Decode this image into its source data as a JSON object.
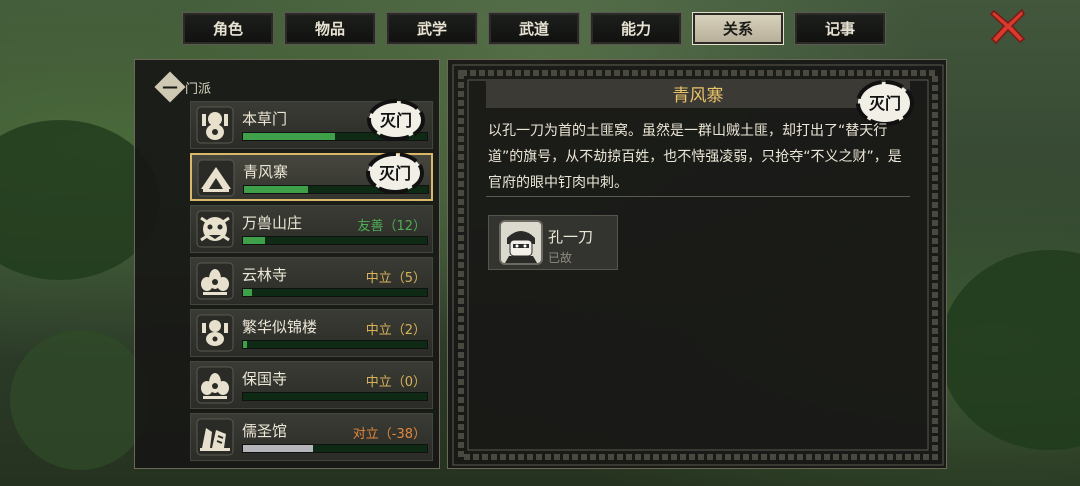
{
  "tabs": [
    {
      "label": "角色",
      "active": false
    },
    {
      "label": "物品",
      "active": false
    },
    {
      "label": "武学",
      "active": false
    },
    {
      "label": "武道",
      "active": false
    },
    {
      "label": "能力",
      "active": false
    },
    {
      "label": "关系",
      "active": true
    },
    {
      "label": "记事",
      "active": false
    }
  ],
  "close_icon": "close-x-icon",
  "group": {
    "toggle_symbol": "—",
    "label": "门派"
  },
  "sects": [
    {
      "name": "本草门",
      "status": "",
      "status_color": "",
      "progress": 0.5,
      "bar_color": "#3fa04a",
      "stamp": "灭门",
      "icon": "gourd-emblem-icon"
    },
    {
      "name": "青风寨",
      "status": "",
      "status_color": "",
      "progress": 0.35,
      "bar_color": "#3fa04a",
      "stamp": "灭门",
      "icon": "mountain-camp-icon"
    },
    {
      "name": "万兽山庄",
      "status": "友善（12）",
      "status_color": "#4fae55",
      "progress": 0.12,
      "bar_color": "#3fa04a",
      "stamp": "",
      "icon": "beast-head-icon"
    },
    {
      "name": "云林寺",
      "status": "中立（5）",
      "status_color": "#d7b358",
      "progress": 0.05,
      "bar_color": "#3fa04a",
      "stamp": "",
      "icon": "lotus-icon"
    },
    {
      "name": "繁华似锦楼",
      "status": "中立（2）",
      "status_color": "#d7b358",
      "progress": 0.02,
      "bar_color": "#3fa04a",
      "stamp": "",
      "icon": "ornate-urn-icon"
    },
    {
      "name": "保国寺",
      "status": "中立（0）",
      "status_color": "#d7b358",
      "progress": 0.0,
      "bar_color": "#3fa04a",
      "stamp": "",
      "icon": "lotus-icon"
    },
    {
      "name": "儒圣馆",
      "status": "对立（-38）",
      "status_color": "#e3873a",
      "progress": 0.38,
      "bar_color": "#b5b5bc",
      "stamp": "",
      "icon": "scroll-brush-icon"
    }
  ],
  "detail": {
    "title": "青风寨",
    "stamp": "灭门",
    "description": "以孔一刀为首的土匪窝。虽然是一群山贼土匪，却打出了“替天行道”的旗号，从不劫掠百姓，也不恃强凌弱，只抢夺“不义之财”，是官府的眼中钉肉中刺。",
    "members": [
      {
        "name": "孔一刀",
        "status": "已故",
        "icon": "bandit-portrait-icon"
      }
    ]
  },
  "colors": {
    "accent_gold": "#e8c36a",
    "selected_border": "#d9b86a",
    "friendly": "#4fae55",
    "neutral": "#d7b358",
    "hostile": "#e3873a",
    "close_red": "#d83a2e"
  }
}
